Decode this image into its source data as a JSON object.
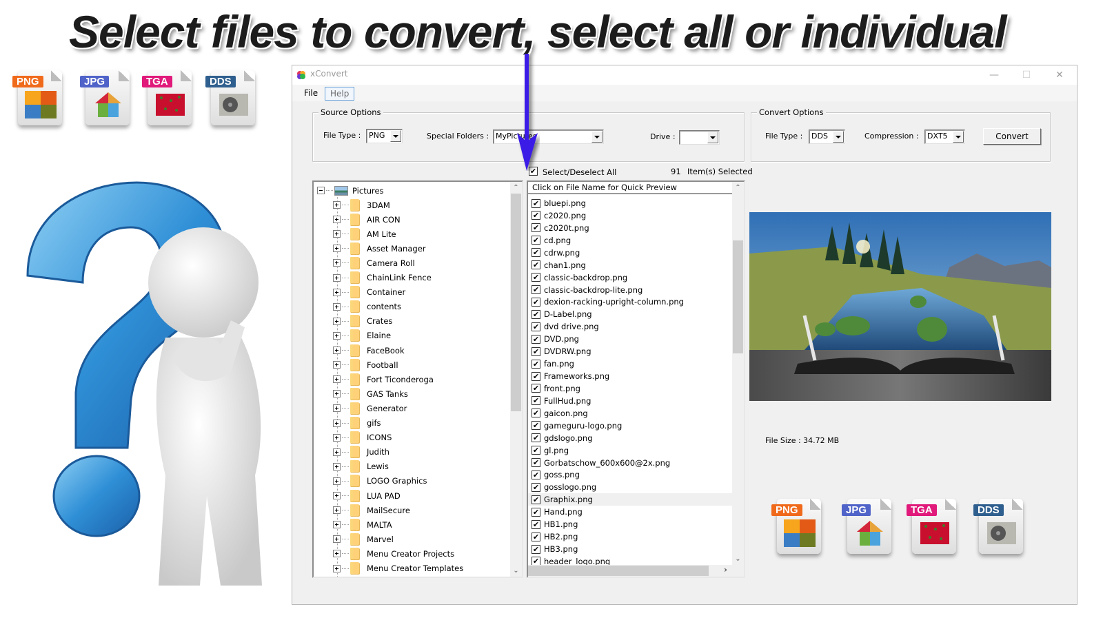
{
  "headline": "Select files to convert, select all or individual",
  "badges": [
    {
      "label": "PNG",
      "color": "#f06a1c",
      "art": "puzzle"
    },
    {
      "label": "JPG",
      "color": "#4f63c8",
      "art": "house-puzzle"
    },
    {
      "label": "TGA",
      "color": "#e0197a",
      "art": "strawberries"
    },
    {
      "label": "DDS",
      "color": "#2f5f8e",
      "art": "air-conditioner"
    }
  ],
  "colors": {
    "arrow": "#3b1ee6",
    "window_bg": "#f0f0f0",
    "menu_highlight_border": "#6aa1d8"
  },
  "window": {
    "title": "xConvert",
    "controls": {
      "minimize": "—",
      "maximize": "☐",
      "close": "✕"
    }
  },
  "menu": {
    "file": "File",
    "help": "Help"
  },
  "source_options": {
    "title": "Source Options",
    "file_type_label": "File Type :",
    "file_type_value": "PNG",
    "special_folders_label": "Special Folders :",
    "special_folders_value": "MyPictures",
    "drive_label": "Drive :",
    "drive_value": ""
  },
  "convert_options": {
    "title": "Convert Options",
    "file_type_label": "File Type :",
    "file_type_value": "DDS",
    "compression_label": "Compression :",
    "compression_value": "DXT5",
    "convert_button": "Convert"
  },
  "selection": {
    "select_all_label": "Select/Deselect All",
    "select_all_checked": true,
    "count": "91",
    "count_label": "Item(s) Selected"
  },
  "tree": {
    "root": "Pictures",
    "folders": [
      "3DAM",
      "AIR CON",
      "AM Lite",
      "Asset Manager",
      "Camera Roll",
      "ChainLink Fence",
      "Container",
      "contents",
      "Crates",
      "Elaine",
      "FaceBook",
      "Football",
      "Fort Ticonderoga",
      "GAS Tanks",
      "Generator",
      "gifs",
      "ICONS",
      "Judith",
      "Lewis",
      "LOGO Graphics",
      "LUA PAD",
      "MailSecure",
      "MALTA",
      "Marvel",
      "Menu Creator Projects",
      "Menu Creator Templates"
    ]
  },
  "file_list": {
    "header": "Click on File Name for Quick Preview",
    "hovered_file": "Graphix.png",
    "files": [
      "bluepi.png",
      "c2020.png",
      "c2020t.png",
      "cd.png",
      "cdrw.png",
      "chan1.png",
      "classic-backdrop.png",
      "classic-backdrop-lite.png",
      "dexion-racking-upright-column.png",
      "D-Label.png",
      "dvd drive.png",
      "DVD.png",
      "DVDRW.png",
      "fan.png",
      "Frameworks.png",
      "front.png",
      "FullHud.png",
      "gaicon.png",
      "gameguru-logo.png",
      "gdslogo.png",
      "gl.png",
      "Gorbatschow_600x600@2x.png",
      "goss.png",
      "gosslogo.png",
      "Graphix.png",
      "Hand.png",
      "HB1.png",
      "HB2.png",
      "HB3.png",
      "header_logo.png"
    ]
  },
  "preview": {
    "description": "open book landscape with stream, grass and mountains",
    "file_size_label": "File Size : 34.72 MB"
  }
}
